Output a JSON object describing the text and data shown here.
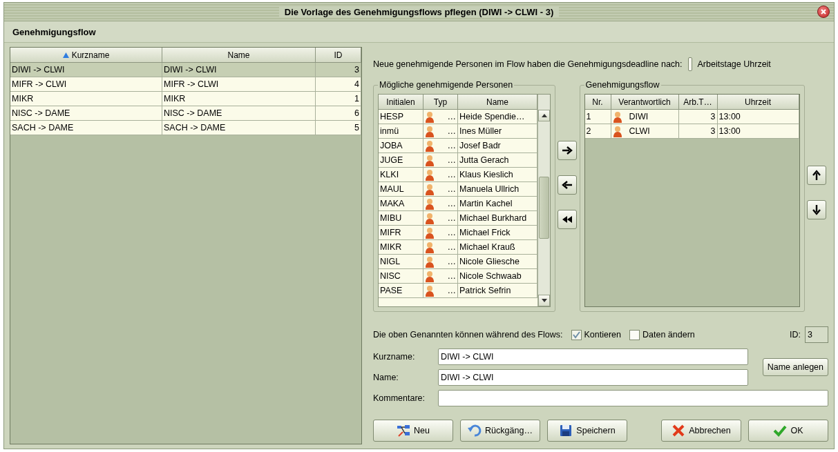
{
  "window": {
    "title": "Die Vorlage des Genehmigungsflows pflegen (DIWI -> CLWI  -  3)"
  },
  "section_title": "Genehmigungsflow",
  "templates_table": {
    "columns": [
      {
        "label": "Kurzname",
        "sorted": true
      },
      {
        "label": "Name",
        "sorted": false
      },
      {
        "label": "ID",
        "sorted": false
      }
    ],
    "rows": [
      {
        "cells": [
          "DIWI -> CLWI",
          "DIWI -> CLWI",
          "3"
        ],
        "selected": true
      },
      {
        "cells": [
          "MIFR -> CLWI",
          "MIFR -> CLWI",
          "4"
        ],
        "selected": false
      },
      {
        "cells": [
          "MIKR",
          "MIKR",
          "1"
        ],
        "selected": false
      },
      {
        "cells": [
          "NISC -> DAME",
          "NISC -> DAME",
          "6"
        ],
        "selected": false
      },
      {
        "cells": [
          "SACH -> DAME",
          "SACH -> DAME",
          "5"
        ],
        "selected": false
      }
    ]
  },
  "deadline": {
    "label": "Neue genehmigende Personen im Flow haben die Genehmigungsdeadline nach:",
    "option_label": "Arbeitstage Uhrzeit"
  },
  "persons": {
    "title": "Mögliche genehmigende Personen",
    "columns": [
      "Initialen",
      "Typ",
      "Name"
    ],
    "rows": [
      {
        "initials": "HESP",
        "type": "…",
        "name": "Heide Spendie…"
      },
      {
        "initials": "inmü",
        "type": "…",
        "name": "Ines Müller"
      },
      {
        "initials": "JOBA",
        "type": "…",
        "name": "Josef Badr"
      },
      {
        "initials": "JUGE",
        "type": "…",
        "name": "Jutta Gerach"
      },
      {
        "initials": "KLKI",
        "type": "…",
        "name": "Klaus Kieslich"
      },
      {
        "initials": "MAUL",
        "type": "…",
        "name": "Manuela Ullrich"
      },
      {
        "initials": "MAKA",
        "type": "…",
        "name": "Martin Kachel"
      },
      {
        "initials": "MIBU",
        "type": "…",
        "name": "Michael Burkhard"
      },
      {
        "initials": "MIFR",
        "type": "…",
        "name": "Michael Frick"
      },
      {
        "initials": "MIKR",
        "type": "…",
        "name": "Michael Krauß"
      },
      {
        "initials": "NIGL",
        "type": "…",
        "name": "Nicole Gliesche"
      },
      {
        "initials": "NISC",
        "type": "…",
        "name": "Nicole Schwaab"
      },
      {
        "initials": "PASE",
        "type": "…",
        "name": "Patrick Sefrin"
      }
    ]
  },
  "transfer_buttons": [
    {
      "kind": "add"
    },
    {
      "kind": "remove"
    },
    {
      "kind": "remove_all"
    }
  ],
  "flow": {
    "title": "Genehmigungsflow",
    "columns": [
      "Nr.",
      "Verantwortlich",
      "Arb.T…",
      "Uhrzeit"
    ],
    "rows": [
      {
        "nr": "1",
        "person": "DIWI",
        "days": "3",
        "time": "13:00"
      },
      {
        "nr": "2",
        "person": "CLWI",
        "days": "3",
        "time": "13:00"
      }
    ]
  },
  "order_buttons": [
    {
      "kind": "up"
    },
    {
      "kind": "down"
    }
  ],
  "permissions": {
    "label": "Die oben Genannten können während des Flows:",
    "options": [
      {
        "label": "Kontieren",
        "checked": true
      },
      {
        "label": "Daten ändern",
        "checked": false
      }
    ]
  },
  "id_field": {
    "label": "ID:",
    "value": "3"
  },
  "fields": [
    {
      "label": "Kurzname:",
      "value": "DIWI -> CLWI"
    },
    {
      "label": "Name:",
      "value": "DIWI -> CLWI"
    },
    {
      "label": "Kommentare:"
    }
  ],
  "name_button": "Name anlegen",
  "buttons": [
    {
      "label": "Neu",
      "kind": "new"
    },
    {
      "label": "Rückgäng…",
      "kind": "undo"
    },
    {
      "label": "Speichern",
      "kind": "save"
    },
    {
      "label": "Abbrechen",
      "kind": "cancel"
    },
    {
      "label": "OK",
      "kind": "ok"
    }
  ]
}
